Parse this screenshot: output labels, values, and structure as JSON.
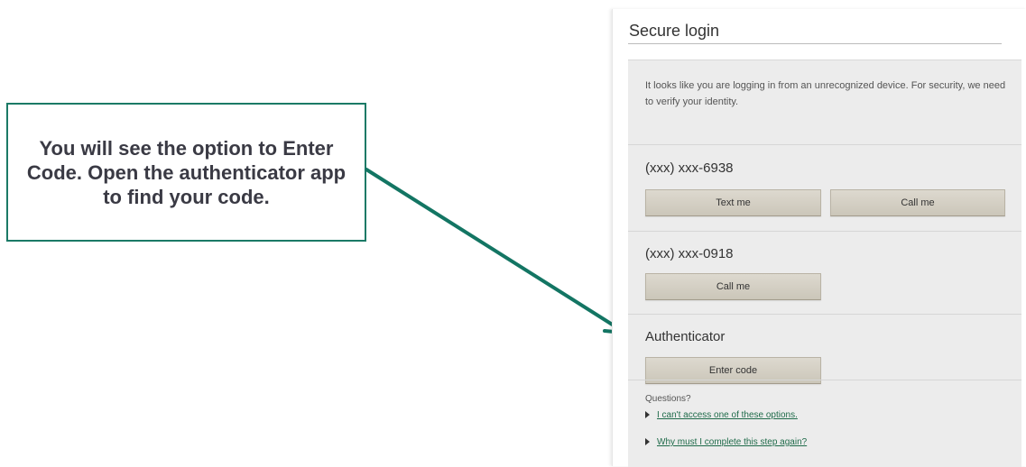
{
  "callout": {
    "text": "You will see the option to Enter Code. Open the authenticator app to find your code."
  },
  "login": {
    "title": "Secure login",
    "intro": "It looks like you are logging in from an unrecognized device. For security, we need to verify your identity.",
    "phone1": {
      "number": "(xxx) xxx-6938",
      "text_label": "Text me",
      "call_label": "Call me"
    },
    "phone2": {
      "number": "(xxx) xxx-0918",
      "call_label": "Call me"
    },
    "authenticator": {
      "label": "Authenticator",
      "enter_label": "Enter code"
    },
    "questions": {
      "heading": "Questions?",
      "links": [
        "I can't access one of these options.",
        "Why must I complete this step again?"
      ]
    }
  },
  "colors": {
    "callout_border": "#1b7a66",
    "arrow": "#137563",
    "button_bg": "#d3cec2",
    "link": "#1f6b4a"
  }
}
